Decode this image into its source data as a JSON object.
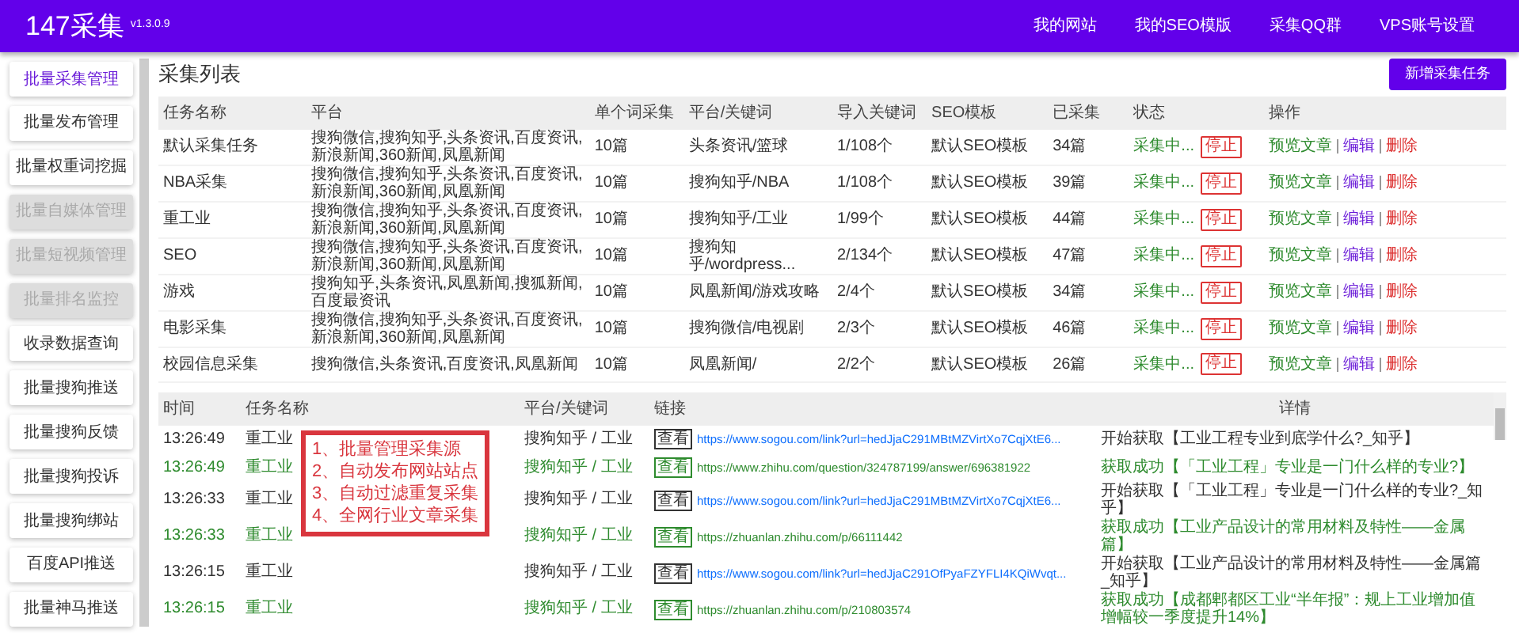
{
  "header": {
    "logo": "147采集",
    "version": "v1.3.0.9",
    "nav": [
      "我的网站",
      "我的SEO模版",
      "采集QQ群",
      "VPS账号设置"
    ]
  },
  "sidebar": {
    "items": [
      {
        "label": "批量采集管理",
        "selected": true,
        "disabled": false
      },
      {
        "label": "批量发布管理",
        "selected": false,
        "disabled": false
      },
      {
        "label": "批量权重词挖掘",
        "selected": false,
        "disabled": false
      },
      {
        "label": "批量自媒体管理",
        "selected": false,
        "disabled": true
      },
      {
        "label": "批量短视频管理",
        "selected": false,
        "disabled": true
      },
      {
        "label": "批量排名监控",
        "selected": false,
        "disabled": true
      },
      {
        "label": "收录数据查询",
        "selected": false,
        "disabled": false
      },
      {
        "label": "批量搜狗推送",
        "selected": false,
        "disabled": false
      },
      {
        "label": "批量搜狗反馈",
        "selected": false,
        "disabled": false
      },
      {
        "label": "批量搜狗投诉",
        "selected": false,
        "disabled": false
      },
      {
        "label": "批量搜狗绑站",
        "selected": false,
        "disabled": false
      },
      {
        "label": "百度API推送",
        "selected": false,
        "disabled": false
      },
      {
        "label": "批量神马推送",
        "selected": false,
        "disabled": false
      }
    ]
  },
  "task_list": {
    "title": "采集列表",
    "add_button": "新增采集任务",
    "columns": [
      "任务名称",
      "平台",
      "单个词采集",
      "平台/关键词",
      "导入关键词",
      "SEO模板",
      "已采集",
      "状态",
      "操作"
    ],
    "rows": [
      {
        "name": "默认采集任务",
        "platform": "搜狗微信,搜狗知乎,头条资讯,百度资讯,新浪新闻,360新闻,凤凰新闻",
        "per_word": "10篇",
        "keyword": "头条资讯/篮球",
        "imported": "1/108个",
        "template": "默认SEO模板",
        "collected": "34篇",
        "status": "采集中...",
        "stop": "停止",
        "actions": [
          "预览文章",
          "编辑",
          "删除"
        ]
      },
      {
        "name": "NBA采集",
        "platform": "搜狗微信,搜狗知乎,头条资讯,百度资讯,新浪新闻,360新闻,凤凰新闻",
        "per_word": "10篇",
        "keyword": "搜狗知乎/NBA",
        "imported": "1/108个",
        "template": "默认SEO模板",
        "collected": "39篇",
        "status": "采集中...",
        "stop": "停止",
        "actions": [
          "预览文章",
          "编辑",
          "删除"
        ]
      },
      {
        "name": "重工业",
        "platform": "搜狗微信,搜狗知乎,头条资讯,百度资讯,新浪新闻,360新闻,凤凰新闻",
        "per_word": "10篇",
        "keyword": "搜狗知乎/工业",
        "imported": "1/99个",
        "template": "默认SEO模板",
        "collected": "44篇",
        "status": "采集中...",
        "stop": "停止",
        "actions": [
          "预览文章",
          "编辑",
          "删除"
        ]
      },
      {
        "name": "SEO",
        "platform": "搜狗微信,搜狗知乎,头条资讯,百度资讯,新浪新闻,360新闻,凤凰新闻",
        "per_word": "10篇",
        "keyword": "搜狗知乎/wordpress...",
        "imported": "2/134个",
        "template": "默认SEO模板",
        "collected": "47篇",
        "status": "采集中...",
        "stop": "停止",
        "actions": [
          "预览文章",
          "编辑",
          "删除"
        ]
      },
      {
        "name": "游戏",
        "platform": "搜狗知乎,头条资讯,凤凰新闻,搜狐新闻,百度最资讯",
        "per_word": "10篇",
        "keyword": "凤凰新闻/游戏攻略",
        "imported": "2/4个",
        "template": "默认SEO模板",
        "collected": "34篇",
        "status": "采集中...",
        "stop": "停止",
        "actions": [
          "预览文章",
          "编辑",
          "删除"
        ]
      },
      {
        "name": "电影采集",
        "platform": "搜狗微信,搜狗知乎,头条资讯,百度资讯,新浪新闻,360新闻,凤凰新闻",
        "per_word": "10篇",
        "keyword": "搜狗微信/电视剧",
        "imported": "2/3个",
        "template": "默认SEO模板",
        "collected": "46篇",
        "status": "采集中...",
        "stop": "停止",
        "actions": [
          "预览文章",
          "编辑",
          "删除"
        ]
      },
      {
        "name": "校园信息采集",
        "platform": "搜狗微信,头条资讯,百度资讯,凤凰新闻",
        "per_word": "10篇",
        "keyword": "凤凰新闻/",
        "imported": "2/2个",
        "template": "默认SEO模板",
        "collected": "26篇",
        "status": "采集中...",
        "stop": "停止",
        "actions": [
          "预览文章",
          "编辑",
          "删除"
        ]
      }
    ]
  },
  "log": {
    "columns": [
      "时间",
      "任务名称",
      "平台/关键词",
      "链接",
      "详情"
    ],
    "rows": [
      {
        "kind": "start",
        "time": "13:26:49",
        "task": "重工业",
        "keyword": "搜狗知乎 / 工业",
        "tag": "查看",
        "link": "https://www.sogou.com/link?url=hedJjaC291MBtMZVirtXo7CqjXtE6...",
        "detail": "开始获取【工业工程专业到底学什么?_知乎】"
      },
      {
        "kind": "success",
        "time": "13:26:49",
        "task": "重工业",
        "keyword": "搜狗知乎 / 工业",
        "tag": "查看",
        "link": "https://www.zhihu.com/question/324787199/answer/696381922",
        "detail": "获取成功【「工业工程」专业是一门什么样的专业?】"
      },
      {
        "kind": "start",
        "time": "13:26:33",
        "task": "重工业",
        "keyword": "搜狗知乎 / 工业",
        "tag": "查看",
        "link": "https://www.sogou.com/link?url=hedJjaC291MBtMZVirtXo7CqjXtE6...",
        "detail": "开始获取【「工业工程」专业是一门什么样的专业?_知乎】"
      },
      {
        "kind": "success",
        "time": "13:26:33",
        "task": "重工业",
        "keyword": "搜狗知乎 / 工业",
        "tag": "查看",
        "link": "https://zhuanlan.zhihu.com/p/66111442",
        "detail": "获取成功【工业产品设计的常用材料及特性——金属篇】"
      },
      {
        "kind": "start",
        "time": "13:26:15",
        "task": "重工业",
        "keyword": "搜狗知乎 / 工业",
        "tag": "查看",
        "link": "https://www.sogou.com/link?url=hedJjaC291OfPyaFZYFLI4KQiWvqt...",
        "detail": "开始获取【工业产品设计的常用材料及特性——金属篇_知乎】"
      },
      {
        "kind": "success",
        "time": "13:26:15",
        "task": "重工业",
        "keyword": "搜狗知乎 / 工业",
        "tag": "查看",
        "link": "https://zhuanlan.zhihu.com/p/210803574",
        "detail": "获取成功【成都郫都区工业“半年报”：规上工业增加值增幅较一季度提升14%】"
      }
    ]
  },
  "callout": {
    "lines": [
      "1、批量管理采集源",
      "2、自动发布网站站点",
      "3、自动过滤重复采集",
      "4、全网行业文章采集"
    ]
  }
}
